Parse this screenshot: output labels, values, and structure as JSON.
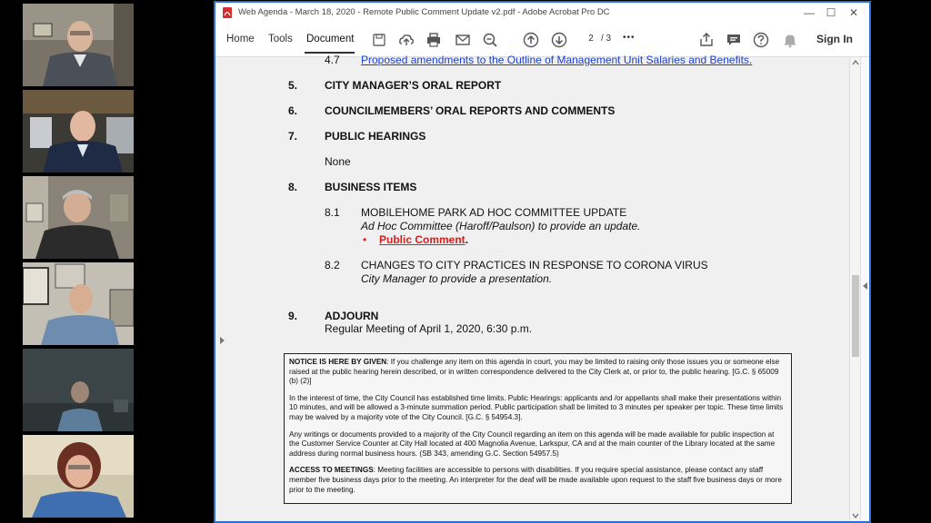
{
  "participants": [
    {
      "label": "participant-1"
    },
    {
      "label": "participant-2"
    },
    {
      "label": "participant-3"
    },
    {
      "label": "participant-4"
    },
    {
      "label": "participant-5"
    },
    {
      "label": "participant-6"
    }
  ],
  "window": {
    "title": "Web Agenda - March 18, 2020 - Remote Public Comment Update v2.pdf - Adobe Acrobat Pro DC",
    "controls": {
      "minimize": "—",
      "maximize": "☐",
      "close": "✕"
    }
  },
  "toolbar": {
    "tabs": [
      "Home",
      "Tools",
      "Document"
    ],
    "active_tab": "Document",
    "page_current": "2",
    "page_total": "/ 3",
    "more": "•••",
    "sign_in": "Sign In"
  },
  "agenda": {
    "item_4_7_num": "4.7",
    "item_4_7_text": "Proposed amendments to the Outline of Management Unit Salaries and Benefits.",
    "item5_num": "5.",
    "item5": "CITY MANAGER’S ORAL REPORT",
    "item6_num": "6.",
    "item6": "COUNCILMEMBERS’ ORAL REPORTS AND COMMENTS",
    "item7_num": "7.",
    "item7": "PUBLIC HEARINGS",
    "item7_none": "None",
    "item8_num": "8.",
    "item8": "BUSINESS ITEMS",
    "item8_1_num": "8.1",
    "item8_1_title": "MOBILEHOME PARK AD HOC COMMITTEE UPDATE",
    "item8_1_desc": "Ad Hoc Committee (Haroff/Paulson) to provide an update.",
    "item8_1_bullet": "•",
    "item8_1_link": "Public Comment",
    "item8_1_period": ".",
    "item8_2_num": "8.2",
    "item8_2_title": "CHANGES TO CITY PRACTICES IN RESPONSE TO CORONA VIRUS",
    "item8_2_desc": "City Manager to provide a presentation.",
    "item9_num": "9.",
    "item9": "ADJOURN",
    "item9_desc": "Regular Meeting of April 1, 2020, 6:30 p.m."
  },
  "notice": {
    "p1_lead": "NOTICE IS HERE BY GIVEN",
    "p1_text": ": If you challenge any item on this agenda in court, you may be limited to raising only those issues you or someone else raised at the public hearing herein described, or in written correspondence delivered to the City Clerk at, or prior to, the public hearing. [G.C. § 65009 (b) (2)]",
    "p2": "In the interest of time, the City Council has established time limits.  Public Hearings: applicants and /or appellants shall make their presentations within 10 minutes, and will be allowed a 3-minute summation period.  Public participation shall be limited to 3 minutes per speaker per topic.  These time limits may be waived by a majority vote of the City Council. [G.C. § 54954.3].",
    "p3": "Any writings or documents provided to a majority of the City Council regarding an item on this agenda will be made available for public inspection at the Customer Service Counter at City Hall located at 400 Magnolia Avenue, Larkspur, CA and at the main counter of the Library located at the same address during normal business hours. (SB 343, amending G.C. Section 54957.5)",
    "p4_lead": "ACCESS TO MEETINGS",
    "p4_text": ": Meeting facilities are accessible to persons with disabilities.  If you require special assistance, please contact any staff member five business days prior to the meeting.  An interpreter for the deaf will be made available upon request to the staff five business days or more prior to the meeting."
  }
}
